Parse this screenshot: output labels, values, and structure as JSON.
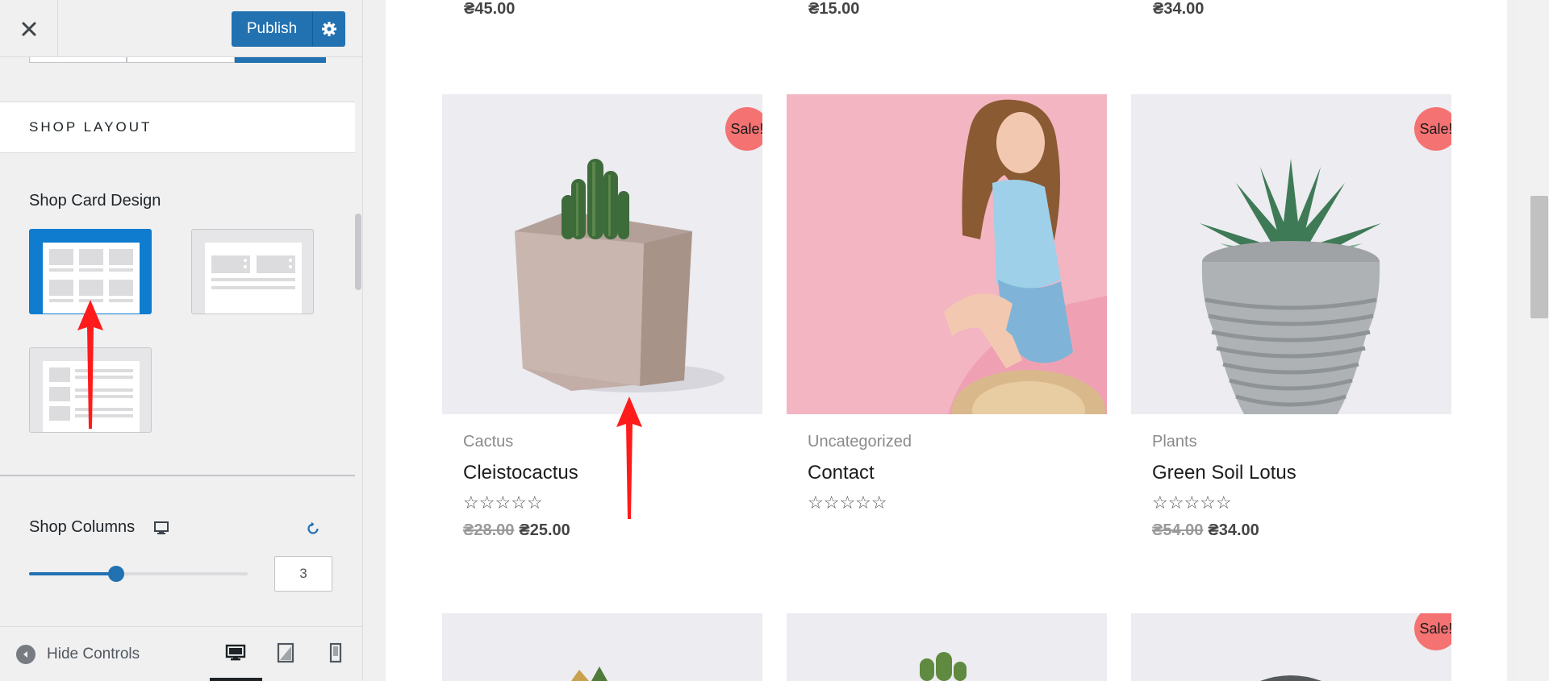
{
  "sidebar": {
    "publish_label": "Publish",
    "section_title": "SHOP LAYOUT",
    "card_design_label": "Shop Card Design",
    "card_designs": [
      {
        "id": "grid",
        "selected": true
      },
      {
        "id": "list",
        "selected": false
      },
      {
        "id": "side",
        "selected": false
      }
    ],
    "columns_label": "Shop Columns",
    "columns_value": "3",
    "columns_fraction": 0.4,
    "hide_controls_label": "Hide Controls",
    "accent_color": "#2271b1"
  },
  "preview": {
    "top_prices": [
      "₴45.00",
      "₴15.00",
      "₴34.00"
    ],
    "products": [
      {
        "category": "Cactus",
        "name": "Cleistocactus",
        "sale": true,
        "sale_label": "Sale!",
        "old_price": "₴28.00",
        "price": "₴25.00",
        "image": "cactus-pot"
      },
      {
        "category": "Uncategorized",
        "name": "Contact",
        "sale": false,
        "sale_label": "",
        "old_price": "",
        "price": "",
        "image": "woman-pink-background"
      },
      {
        "category": "Plants",
        "name": "Green Soil Lotus",
        "sale": true,
        "sale_label": "Sale!",
        "old_price": "₴54.00",
        "price": "₴34.00",
        "image": "succulent-rope-pot"
      }
    ],
    "next_row_sale_label": "Sale!",
    "sale_color": "#f47272",
    "rating_stars": "☆☆☆☆☆"
  }
}
